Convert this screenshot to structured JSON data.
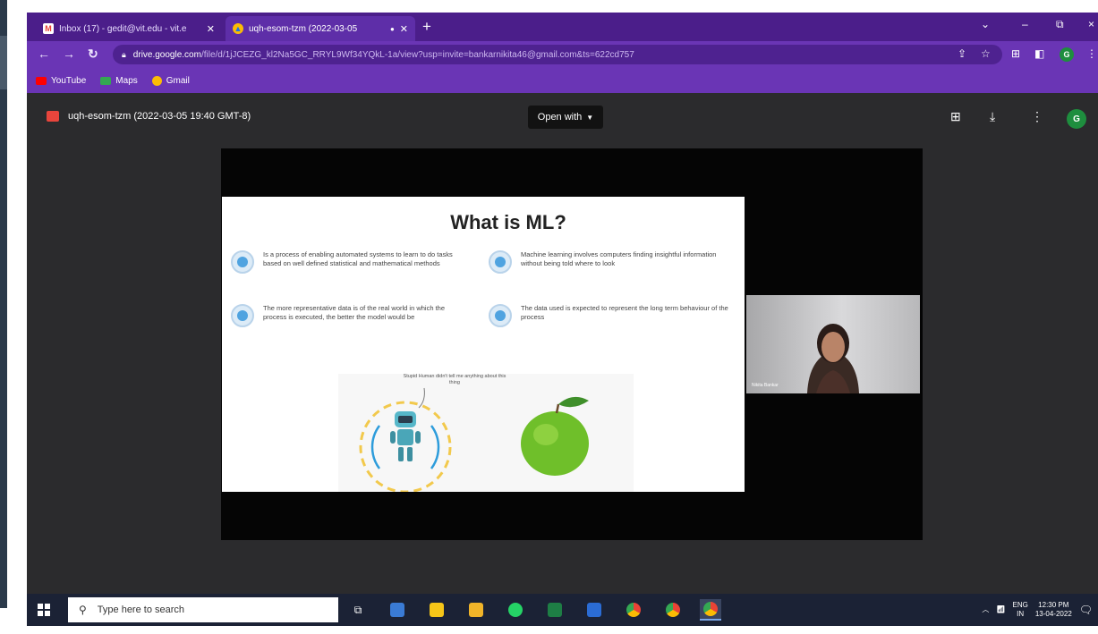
{
  "browser": {
    "tabs": [
      {
        "title": "Inbox (17) - gedit@vit.edu - vit.e",
        "active": false
      },
      {
        "title": "uqh-esom-tzm (2022-03-05",
        "active": true
      }
    ],
    "new_tab": "+",
    "window_controls": {
      "dropdown": "⌄",
      "minimize": "–",
      "restore": "⧉",
      "close": "×"
    },
    "address": {
      "domain": "drive.google.com",
      "path": "/file/d/1jJCEZG_kl2Na5GC_RRYL9Wf34YQkL-1a/view?usp=invite=bankarnikita46@gmail.com&ts=622cd757"
    },
    "profile_initial": "G",
    "bookmarks": [
      {
        "label": "YouTube",
        "color": "#ff0000"
      },
      {
        "label": "Maps",
        "color": "#34a853"
      },
      {
        "label": "Gmail",
        "color": "#fbbc04"
      }
    ]
  },
  "viewer": {
    "file_name": "uqh-esom-tzm (2022-03-05 19:40 GMT-8)",
    "open_with": "Open with",
    "profile_initial": "G"
  },
  "slide": {
    "title": "What is ML?",
    "bullets": [
      "Is a process of enabling automated systems to learn to do tasks based on well defined statistical and mathematical methods",
      "Machine learning involves computers finding insightful information without being told where to look",
      "The more representative data is of the real world in which the process is executed, the better the model would be",
      "The data used is expected to represent the long term behaviour of the process"
    ],
    "speech_bubble": "Stupid Human didn't tell me anything about this thing"
  },
  "video": {
    "participant_name": "Nikita Bankar"
  },
  "taskbar": {
    "search_placeholder": "Type here to search",
    "tray": {
      "lang": "ENG",
      "region": "IN",
      "time": "12:30 PM",
      "date": "13-04-2022"
    }
  },
  "colors": {
    "chrome_tabstrip": "#4b1e8a",
    "chrome_toolbar": "#6a35b5",
    "viewer_bg": "#2b2b2d",
    "taskbar": "#1b2235"
  }
}
